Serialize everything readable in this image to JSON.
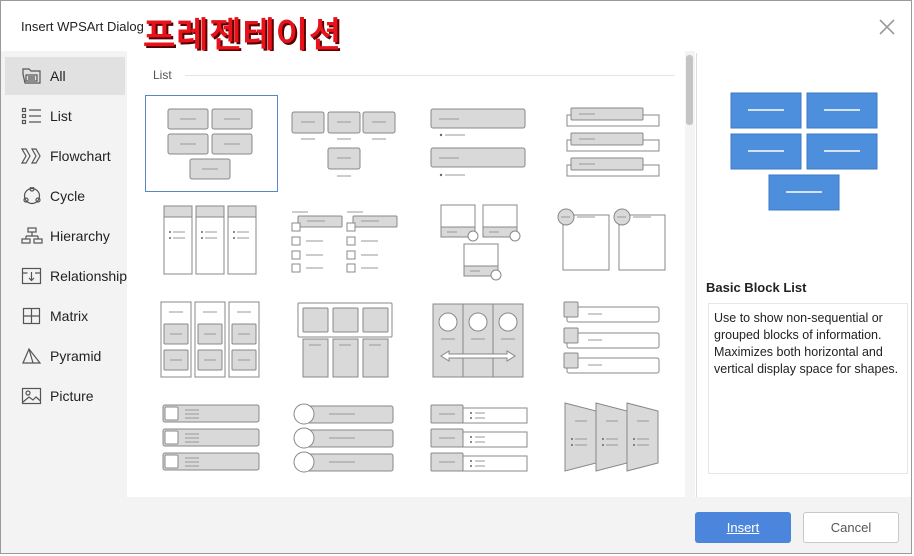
{
  "window": {
    "title": "Insert WPSArt Dialog",
    "overlay_text": "프레젠테이션"
  },
  "sidebar": {
    "items": [
      {
        "label": "All",
        "icon": "all-icon"
      },
      {
        "label": "List",
        "icon": "list-icon"
      },
      {
        "label": "Flowchart",
        "icon": "flowchart-icon"
      },
      {
        "label": "Cycle",
        "icon": "cycle-icon"
      },
      {
        "label": "Hierarchy",
        "icon": "hierarchy-icon"
      },
      {
        "label": "Relationship",
        "icon": "relationship-icon"
      },
      {
        "label": "Matrix",
        "icon": "matrix-icon"
      },
      {
        "label": "Pyramid",
        "icon": "pyramid-icon"
      },
      {
        "label": "Picture",
        "icon": "picture-icon"
      }
    ],
    "selected": "All"
  },
  "gallery": {
    "section_label": "List",
    "selected_index": 0
  },
  "preview": {
    "name": "Basic Block List",
    "description": "Use to show non-sequential or grouped blocks of information. Maximizes both horizontal and vertical display space for shapes."
  },
  "buttons": {
    "insert": "Insert",
    "cancel": "Cancel"
  },
  "colors": {
    "accent": "#4c86dc",
    "preview_block": "#4d8fdd",
    "shape_fill": "#d9d9d9",
    "overlay": "#e8131a"
  }
}
